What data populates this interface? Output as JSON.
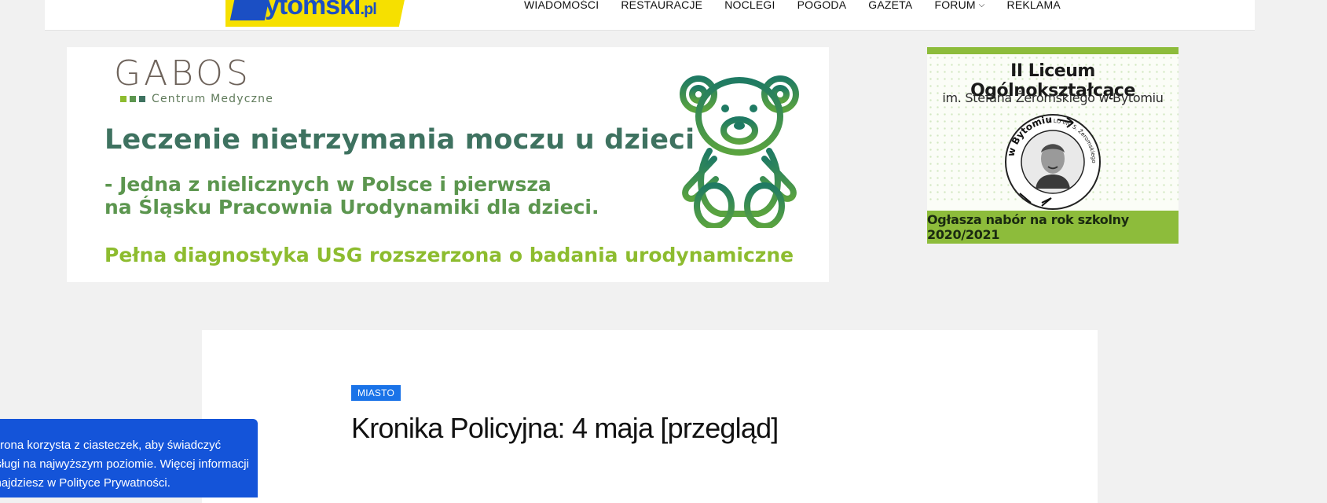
{
  "header": {
    "logo_text": "ytomski",
    "logo_tld": ".pl",
    "nav": [
      {
        "label": "WIADOMOŚCI"
      },
      {
        "label": "RESTAURACJE"
      },
      {
        "label": "NOCLEGI"
      },
      {
        "label": "POGODA"
      },
      {
        "label": "GAZETA"
      },
      {
        "label": "FORUM",
        "chevron": "⌵"
      },
      {
        "label": "REKLAMA"
      }
    ]
  },
  "ad_gabos": {
    "brand": "GABOS",
    "brand_sub": "Centrum Medyczne",
    "headline": "Leczenie nietrzymania moczu u dzieci",
    "line2a": "- Jedna z nielicznych w Polsce i pierwsza",
    "line2b": "na Śląsku Pracownia Urodynamiki dla dzieci.",
    "line3": "Pełna diagnostyka USG rozszerzona o badania urodynamiczne",
    "colors": {
      "dark": "#3e7260",
      "mid": "#5c964f",
      "light": "#8dbc2f"
    },
    "icon": "teddy-bear-icon"
  },
  "ad_school": {
    "title": "II Liceum Ogólnokształcące",
    "subtitle": "im. Stefana Żeromskiego w Bytomiu",
    "seal_top": "w Bytomiu",
    "seal_right": "II LO im. S. Żeromskiego",
    "footer": "Ogłasza nabór na rok szkolny 2020/2021",
    "accent": "#8dbc3b"
  },
  "article": {
    "category": "MIASTO",
    "title": "Kronika Policyjna: 4 maja [przegląd]"
  },
  "cookie": {
    "text": "Strona korzysta z ciasteczek, aby świadczyć usługi na najwyższym poziomie. Więcej informacji znajdziesz w Polityce Prywatności."
  }
}
